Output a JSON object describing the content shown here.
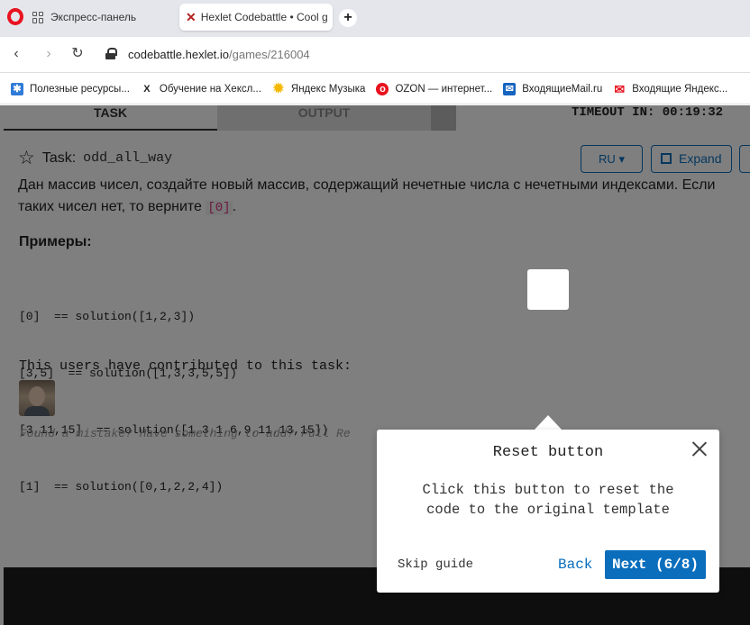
{
  "browser": {
    "tabs": [
      {
        "label": "Экспресс-панель"
      },
      {
        "label": "Hexlet Codebattle • Cool g"
      }
    ],
    "new_tab": "+",
    "url_host": "codebattle.hexlet.io",
    "url_path": "/games/216004",
    "bookmarks": [
      {
        "label": "Полезные ресурсы...",
        "icon": "puzzle-icon",
        "color": "#2f7bd8"
      },
      {
        "label": "Обучение на Хексл...",
        "icon": "hexlet-icon",
        "color": "#222222"
      },
      {
        "label": "Яндекс Музыка",
        "icon": "yandex-music-icon",
        "color": "#f5b800"
      },
      {
        "label": "OZON — интернет...",
        "icon": "ozon-icon",
        "color": "#e8121e"
      },
      {
        "label": "ВходящиеMail.ru",
        "icon": "mail-ru-icon",
        "color": "#1565c0"
      },
      {
        "label": "Входящие Яндекс...",
        "icon": "yandex-mail-icon",
        "color": "#e8121e"
      }
    ]
  },
  "panel": {
    "tab_task": "TASK",
    "tab_output": "OUTPUT",
    "timeout": "TIMEOUT IN: 00:19:32"
  },
  "task": {
    "label": "Task:",
    "name": "odd_all_way",
    "lang_button": "RU",
    "expand_button": "Expand",
    "description_1": "Дан массив чисел, создайте новый массив, содержащий нечетные числа с нечетными индексами. Если",
    "description_2": "таких чисел нет, то верните ",
    "description_code": "[0]",
    "description_end": ".",
    "examples_heading": "Примеры:",
    "examples": [
      "[0]  == solution([1,2,3])",
      "[3,5]  == solution([1,3,3,5,5])",
      "[3,11,15]  == solution([1,3,1,6,9,11,13,15])",
      "[1]  == solution([0,1,2,2,4])"
    ],
    "contributors_text": "This users have contributed to this task:",
    "found_text": "Found a mistake? Have something to add? Pull Re"
  },
  "guide": {
    "title": "Reset button",
    "text": "Click this button to reset the code to the original template",
    "skip": "Skip guide",
    "back": "Back",
    "next": "Next (6/8)"
  }
}
